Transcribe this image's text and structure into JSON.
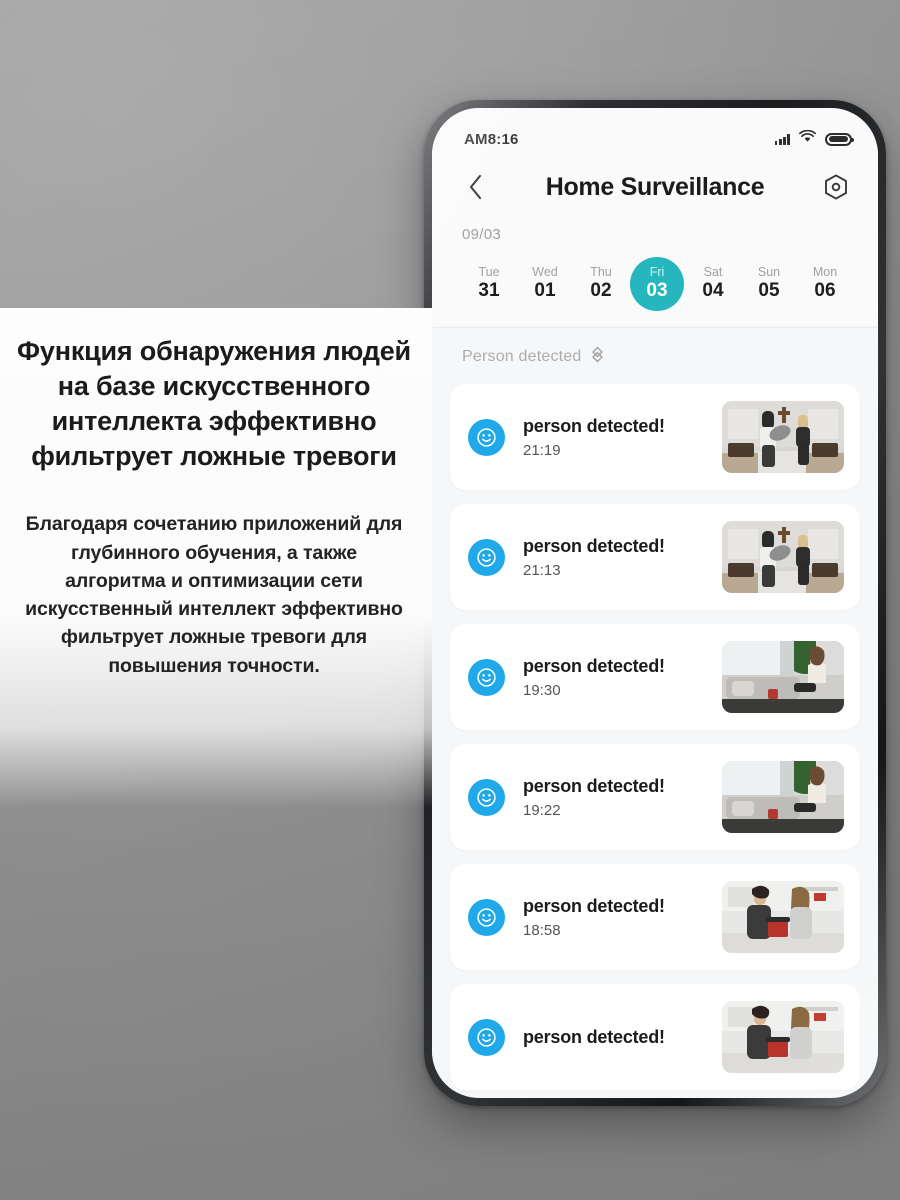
{
  "promo": {
    "heading": "Функция обнаружения людей на базе искусственного интеллекта эффективно фильтрует ложные тревоги",
    "body": "Благодаря сочетанию приложений для глубинного обучения, а также алгоритма и оптимизации сети искусственный интеллект эффективно фильтрует ложные тревоги для повышения точности."
  },
  "status_bar": {
    "time": "AM8:16",
    "signal_icon": "signal-bars-icon",
    "wifi_icon": "wifi-icon",
    "battery_icon": "battery-full-icon"
  },
  "app_bar": {
    "back_icon": "chevron-left-icon",
    "title": "Home  Surveillance",
    "settings_icon": "hex-nut-settings-icon"
  },
  "date_strip": {
    "month_label": "09/03",
    "days": [
      {
        "dow": "Tue",
        "num": "31",
        "active": false
      },
      {
        "dow": "Wed",
        "num": "01",
        "active": false
      },
      {
        "dow": "Thu",
        "num": "02",
        "active": false
      },
      {
        "dow": "Fri",
        "num": "03",
        "active": true
      },
      {
        "dow": "Sat",
        "num": "04",
        "active": false
      },
      {
        "dow": "Sun",
        "num": "05",
        "active": false
      },
      {
        "dow": "Mon",
        "num": "06",
        "active": false
      }
    ],
    "active_color": "#25b7bd"
  },
  "filter": {
    "label": "Person detected",
    "sort_icon": "sort-updown-icon"
  },
  "events": [
    {
      "title": "person detected!",
      "time": "21:19",
      "avatar_icon": "smiley-face-icon",
      "thumb": "pillow-fight-scene"
    },
    {
      "title": "person detected!",
      "time": "21:13",
      "avatar_icon": "smiley-face-icon",
      "thumb": "pillow-fight-scene"
    },
    {
      "title": "person detected!",
      "time": "19:30",
      "avatar_icon": "smiley-face-icon",
      "thumb": "living-room-sofa-scene"
    },
    {
      "title": "person detected!",
      "time": "19:22",
      "avatar_icon": "smiley-face-icon",
      "thumb": "living-room-sofa-scene"
    },
    {
      "title": "person detected!",
      "time": "18:58",
      "avatar_icon": "smiley-face-icon",
      "thumb": "kitchen-couple-scene"
    },
    {
      "title": "person detected!",
      "time": "",
      "avatar_icon": "smiley-face-icon",
      "thumb": "kitchen-couple-scene"
    }
  ],
  "colors": {
    "avatar_blue": "#1fa9e8",
    "accent_teal": "#25b7bd",
    "background_gray": "#989898",
    "card_white": "#ffffff"
  }
}
